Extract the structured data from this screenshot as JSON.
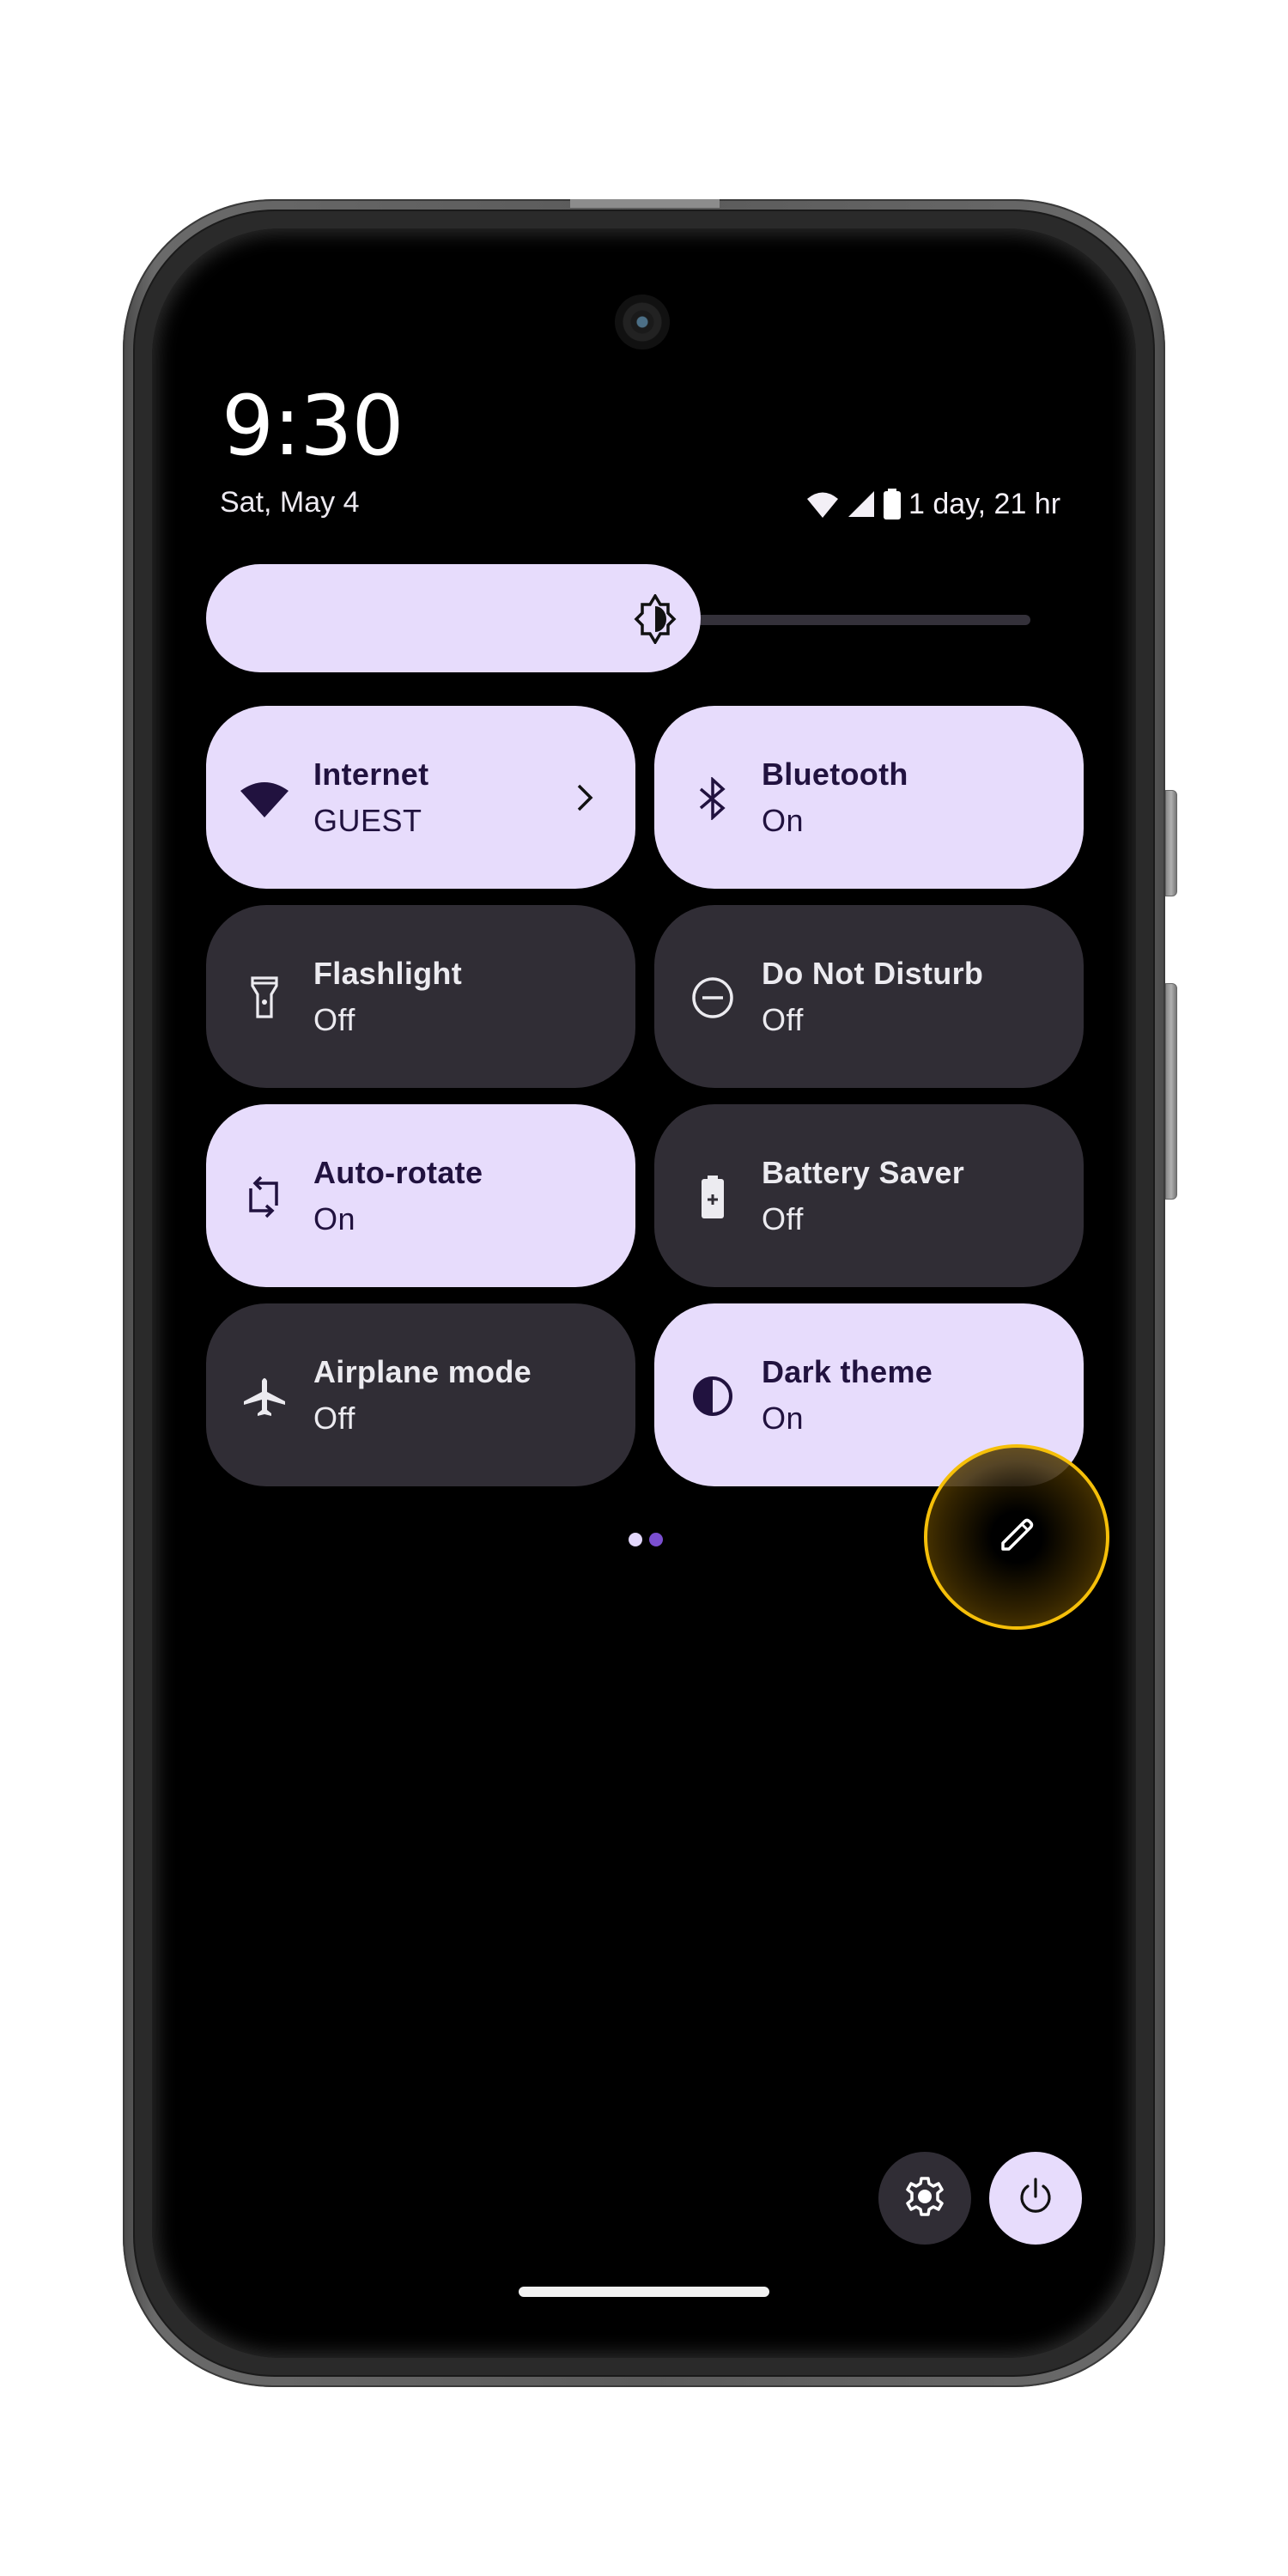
{
  "status_bar": {
    "time": "9:30",
    "date": "Sat, May 4",
    "battery_estimate": "1 day, 21 hr",
    "icons": [
      "wifi-icon",
      "cellular-signal-icon",
      "battery-icon"
    ]
  },
  "brightness": {
    "level": 0.6,
    "icon": "brightness-auto-icon"
  },
  "tiles": [
    {
      "title": "Internet",
      "subtitle": "GUEST",
      "state": "on",
      "icon": "wifi-icon",
      "has_chevron": true
    },
    {
      "title": "Bluetooth",
      "subtitle": "On",
      "state": "on",
      "icon": "bluetooth-icon"
    },
    {
      "title": "Flashlight",
      "subtitle": "Off",
      "state": "off",
      "icon": "flashlight-icon"
    },
    {
      "title": "Do Not Disturb",
      "subtitle": "Off",
      "state": "off",
      "icon": "do-not-disturb-icon"
    },
    {
      "title": "Auto-rotate",
      "subtitle": "On",
      "state": "on",
      "icon": "auto-rotate-icon"
    },
    {
      "title": "Battery Saver",
      "subtitle": "Off",
      "state": "off",
      "icon": "battery-saver-icon"
    },
    {
      "title": "Airplane mode",
      "subtitle": "Off",
      "state": "off",
      "icon": "airplane-icon"
    },
    {
      "title": "Dark theme",
      "subtitle": "On",
      "state": "on",
      "icon": "dark-theme-icon"
    }
  ],
  "pager": {
    "pages": 2,
    "current": 2
  },
  "actions": {
    "edit": "edit-icon",
    "settings": "settings-gear-icon",
    "power": "power-icon"
  },
  "colors": {
    "tile_on": "#e7dcfc",
    "tile_off": "#302d35",
    "on_text": "#21123f",
    "accent_dot": "#7b4fd0",
    "touch_indicator": "#f5bf09"
  }
}
